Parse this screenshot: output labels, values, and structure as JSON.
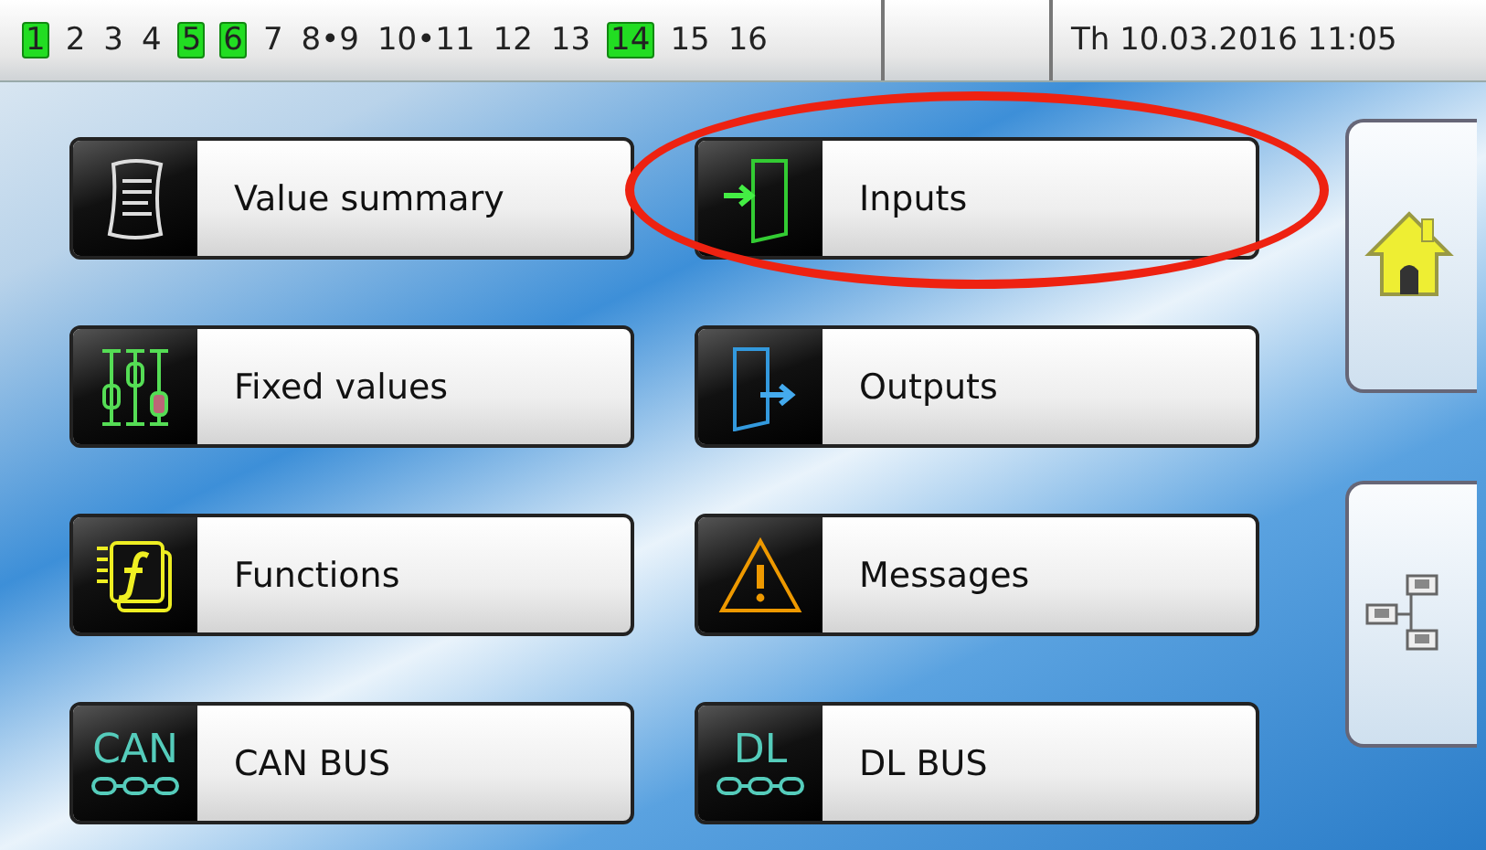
{
  "status_bar": {
    "channels": [
      {
        "label": "1",
        "active": true
      },
      {
        "label": "2",
        "active": false
      },
      {
        "label": "3",
        "active": false
      },
      {
        "label": "4",
        "active": false
      },
      {
        "label": "5",
        "active": true
      },
      {
        "label": "6",
        "active": true
      },
      {
        "label": "7",
        "active": false
      },
      {
        "label": "8•9",
        "active": false
      },
      {
        "label": "10•11",
        "active": false
      },
      {
        "label": "12",
        "active": false
      },
      {
        "label": "13",
        "active": false
      },
      {
        "label": "14",
        "active": true
      },
      {
        "label": "15",
        "active": false
      },
      {
        "label": "16",
        "active": false
      }
    ],
    "date": "Th 10.03.2016 11:05"
  },
  "menu": [
    {
      "label": "Value summary",
      "kind": "summary",
      "highlighted": false
    },
    {
      "label": "Inputs",
      "kind": "inputs",
      "highlighted": true
    },
    {
      "label": "Fixed values",
      "kind": "fixed",
      "highlighted": false
    },
    {
      "label": "Outputs",
      "kind": "outputs",
      "highlighted": false
    },
    {
      "label": "Functions",
      "kind": "functions",
      "highlighted": false
    },
    {
      "label": "Messages",
      "kind": "messages",
      "highlighted": false
    },
    {
      "label": "CAN BUS",
      "kind": "bus",
      "icon_text": "CAN",
      "highlighted": false
    },
    {
      "label": "DL BUS",
      "kind": "bus",
      "icon_text": "DL",
      "highlighted": false
    }
  ],
  "side_buttons": [
    {
      "kind": "home"
    },
    {
      "kind": "network"
    }
  ]
}
